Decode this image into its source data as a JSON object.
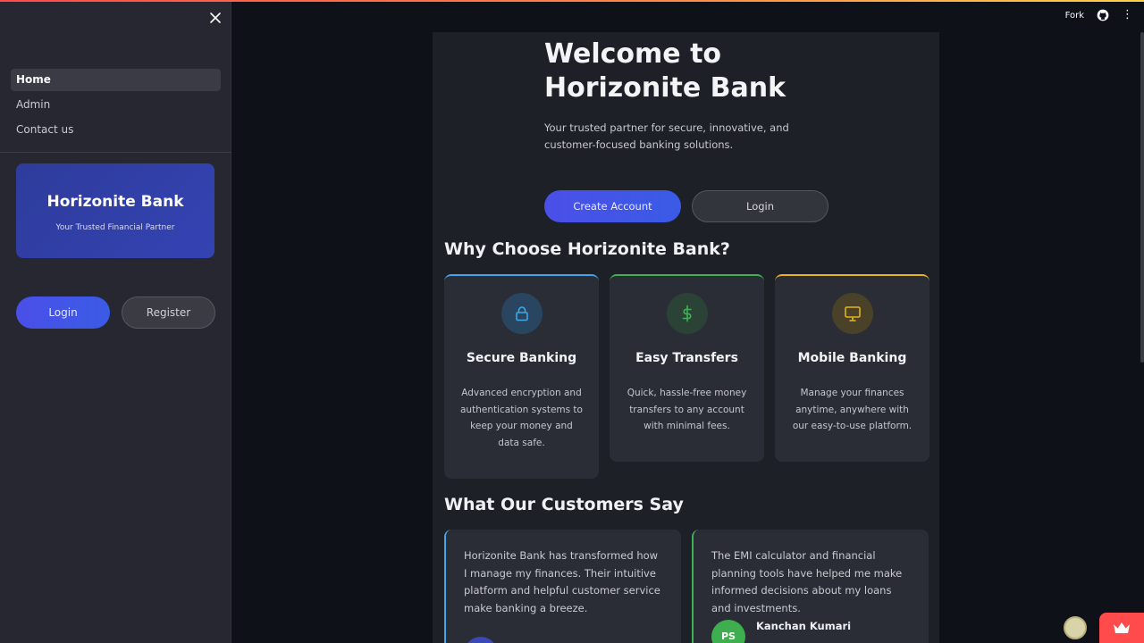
{
  "header": {
    "fork_label": "Fork"
  },
  "sidebar": {
    "nav": [
      {
        "label": "Home",
        "active": true
      },
      {
        "label": "Admin"
      },
      {
        "label": "Contact us"
      }
    ],
    "brand_title": "Horizonite Bank",
    "brand_subtitle": "Your Trusted Financial Partner",
    "login_label": "Login",
    "register_label": "Register"
  },
  "hero": {
    "title": "Welcome to Horizonite Bank",
    "subtitle": "Your trusted partner for secure, innovative, and customer-focused banking solutions.",
    "create_label": "Create Account",
    "login_label": "Login"
  },
  "features": {
    "title": "Why Choose Horizonite Bank?",
    "items": [
      {
        "icon": "lock-icon",
        "name": "Secure Banking",
        "desc": "Advanced encryption and authentication systems to keep your money and data safe."
      },
      {
        "icon": "dollar-icon",
        "name": "Easy Transfers",
        "desc": "Quick, hassle-free money transfers to any account with minimal fees."
      },
      {
        "icon": "monitor-icon",
        "name": "Mobile Banking",
        "desc": "Manage your finances anytime, anywhere with our easy-to-use platform."
      }
    ]
  },
  "testimonials": {
    "title": "What Our Customers Say",
    "items": [
      {
        "quote": "Horizonite Bank has transformed how I manage my finances. Their intuitive platform and helpful customer service make banking a breeze.",
        "initials": "",
        "name": ""
      },
      {
        "quote": "The EMI calculator and financial planning tools have helped me make informed decisions about my loans and investments.",
        "initials": "PS",
        "name": "Kanchan Kumari"
      }
    ]
  },
  "colors": {
    "accent": "#4a4fe8",
    "secure": "#3fa7e8",
    "transfers": "#3fb054",
    "mobile": "#e6b21e",
    "streamlit_red": "#ff4b4b"
  }
}
